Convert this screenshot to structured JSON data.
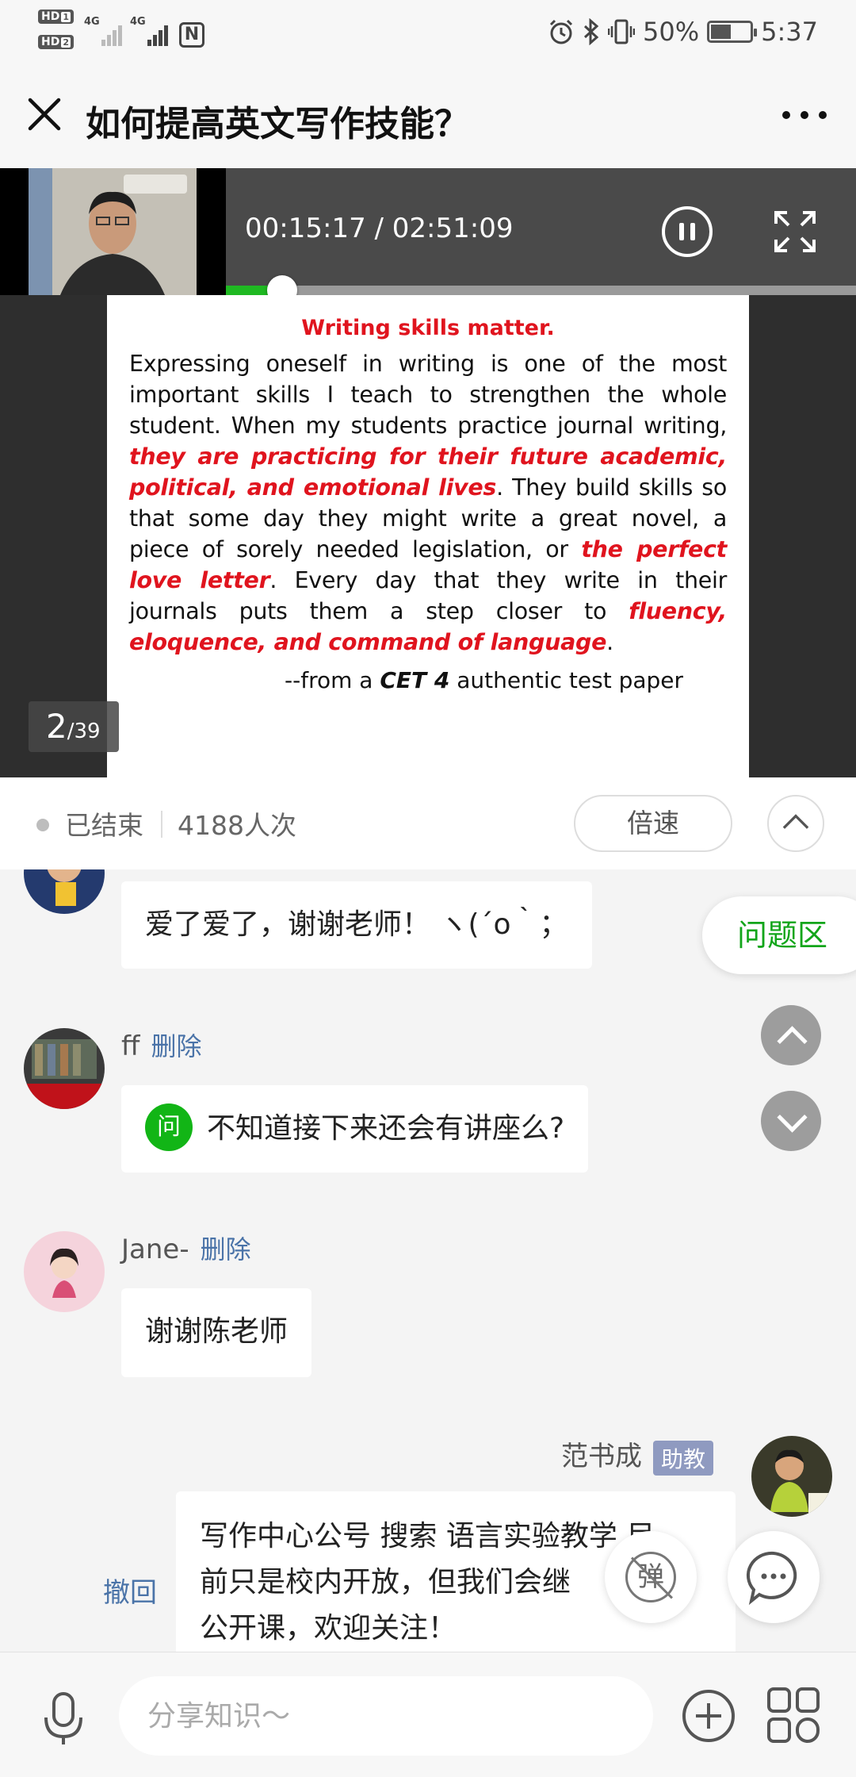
{
  "status_bar": {
    "hd1": "HD",
    "hd1_sub": "1",
    "hd2": "HD",
    "hd2_sub": "2",
    "net1": "4G",
    "net2": "4G",
    "battery_text": "50%",
    "battery_level": 0.5,
    "time": "5:37",
    "icons": [
      "alarm-icon",
      "bluetooth-icon",
      "vibrate-icon",
      "battery-icon",
      "nfc-icon"
    ]
  },
  "header": {
    "title": "如何提高英文写作技能？"
  },
  "player": {
    "time": "00:15:17 / 02:51:09",
    "progress": 0.0895,
    "page_current": "2",
    "page_total": "/39",
    "slide": {
      "title": "Writing skills matter.",
      "p1": "Expressing oneself in writing is one of the most important skills I teach to strengthen the whole student. When my students practice journal writing, ",
      "red1": "they are practicing for their future academic, political, and emotional lives",
      "p2": ". They build skills so that some day they might write a great novel, a piece of sorely needed legislation, or ",
      "red2": "the perfect love letter",
      "p3": ". Every day that they write in their journals puts them a step closer to ",
      "red3": "fluency, eloquence, and command of language",
      "p4": ".",
      "source_prefix": "--from a ",
      "source_bold": "CET 4",
      "source_suffix": " authentic test paper"
    }
  },
  "info_bar": {
    "state": "已结束",
    "views": "4188人次",
    "speed_label": "倍速"
  },
  "qa_tab": "问题区",
  "messages": [
    {
      "sender": "",
      "text": "爱了爱了，谢谢老师！ ヽ(´o｀；"
    },
    {
      "sender": "ff",
      "delete_label": "删除",
      "question_badge": "问",
      "text": "不知道接下来还会有讲座么?"
    },
    {
      "sender": "Jane-",
      "delete_label": "删除",
      "text": "谢谢陈老师"
    },
    {
      "sender": "范书成",
      "role": "助教",
      "recall_label": "撤回",
      "lines": [
        "写作中心公号 搜索 语言实验教学 目",
        "前只是校内开放，但我们会继",
        "公开课，欢迎关注！"
      ]
    }
  ],
  "floating": {
    "danmu_label": "弹"
  },
  "input_bar": {
    "placeholder": "分享知识～"
  },
  "colors": {
    "accent_green": "#1fb922",
    "slide_red": "#e0141e",
    "link_blue": "#4a73a8",
    "role_badge": "#8f9ac0"
  }
}
